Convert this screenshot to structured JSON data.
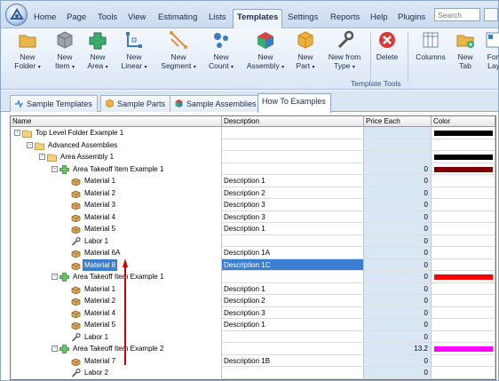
{
  "menu": {
    "items": [
      "Home",
      "Page",
      "Tools",
      "View",
      "Estimating",
      "Lists",
      "Templates",
      "Settings",
      "Reports",
      "Help",
      "Plugins"
    ],
    "active": "Templates",
    "search_placeholder": "Search"
  },
  "ribbon": {
    "buttons": [
      {
        "line1": "New",
        "line2": "Folder",
        "caret": true,
        "icon": "folder-icon"
      },
      {
        "line1": "New",
        "line2": "Item",
        "caret": true,
        "icon": "cube-icon"
      },
      {
        "line1": "New",
        "line2": "Area",
        "caret": true,
        "icon": "area-icon"
      },
      {
        "line1": "New",
        "line2": "Linear",
        "caret": true,
        "icon": "linear-icon"
      },
      {
        "line1": "New",
        "line2": "Segment",
        "caret": true,
        "icon": "segment-icon"
      },
      {
        "line1": "New",
        "line2": "Count",
        "caret": true,
        "icon": "count-icon"
      },
      {
        "line1": "New",
        "line2": "Assembly",
        "caret": true,
        "icon": "assembly-icon"
      },
      {
        "line1": "New",
        "line2": "Part",
        "caret": true,
        "icon": "part-icon"
      },
      {
        "line1": "New from",
        "line2": "Type",
        "caret": true,
        "icon": "wrench-icon"
      },
      {
        "line1": "Delete",
        "line2": "",
        "caret": false,
        "icon": "delete-icon"
      },
      {
        "line1": "Columns",
        "line2": "",
        "caret": false,
        "icon": "columns-icon"
      },
      {
        "line1": "New",
        "line2": "Tab",
        "caret": false,
        "icon": "new-tab-icon"
      },
      {
        "line1": "Fon",
        "line2": "Lay",
        "caret": false,
        "icon": "layout-icon"
      }
    ],
    "group_label": "Template Tools"
  },
  "tabs": [
    {
      "label": "Sample Templates",
      "icon": "templates-icon"
    },
    {
      "label": "Sample Parts",
      "icon": "parts-icon"
    },
    {
      "label": "Sample Assemblies",
      "icon": "assemblies-icon"
    },
    {
      "label": "How To Examples",
      "icon": ""
    }
  ],
  "active_tab": "How To Examples",
  "grid": {
    "columns": [
      "Name",
      "Description",
      "Price Each",
      "Color"
    ],
    "rows": [
      {
        "level": 0,
        "type": "folder",
        "name": "Top Level Folder Example 1",
        "desc": "",
        "price": "",
        "color": "#000000",
        "expander": "-"
      },
      {
        "level": 1,
        "type": "folder",
        "name": "Advanced Assemblies",
        "desc": "",
        "price": "",
        "color": "",
        "expander": "-"
      },
      {
        "level": 2,
        "type": "folder",
        "name": "Area Assembly 1",
        "desc": "",
        "price": "",
        "color": "#000000",
        "expander": "-"
      },
      {
        "level": 3,
        "type": "area",
        "name": "Area Takeoff Item Example 1",
        "desc": "",
        "price": "0",
        "color": "#7f0000",
        "expander": "-"
      },
      {
        "level": 4,
        "type": "material",
        "name": "Material 1",
        "desc": "Description 1",
        "price": "0",
        "color": ""
      },
      {
        "level": 4,
        "type": "material",
        "name": "Material 2",
        "desc": "Description 2",
        "price": "0",
        "color": ""
      },
      {
        "level": 4,
        "type": "material",
        "name": "Material 3",
        "desc": "Description 3",
        "price": "0",
        "color": ""
      },
      {
        "level": 4,
        "type": "material",
        "name": "Material 4",
        "desc": "Description 3",
        "price": "0",
        "color": ""
      },
      {
        "level": 4,
        "type": "material",
        "name": "Material 5",
        "desc": "Description 1",
        "price": "0",
        "color": ""
      },
      {
        "level": 4,
        "type": "labor",
        "name": "Labor 1",
        "desc": "",
        "price": "0",
        "color": ""
      },
      {
        "level": 4,
        "type": "material",
        "name": "Material 6A",
        "desc": "Description 1A",
        "price": "0",
        "color": ""
      },
      {
        "level": 4,
        "type": "material",
        "name": "Material 8",
        "desc": "Description 1C",
        "price": "0",
        "color": "",
        "selected": true
      },
      {
        "level": 3,
        "type": "area",
        "name": "Area Takeoff Item Example 1",
        "desc": "",
        "price": "0",
        "color": "#ff0000",
        "expander": "-"
      },
      {
        "level": 4,
        "type": "material",
        "name": "Material 1",
        "desc": "Description 1",
        "price": "0",
        "color": ""
      },
      {
        "level": 4,
        "type": "material",
        "name": "Material 2",
        "desc": "Description 2",
        "price": "0",
        "color": ""
      },
      {
        "level": 4,
        "type": "material",
        "name": "Material 4",
        "desc": "Description 3",
        "price": "0",
        "color": ""
      },
      {
        "level": 4,
        "type": "material",
        "name": "Material 5",
        "desc": "Description 1",
        "price": "0",
        "color": ""
      },
      {
        "level": 4,
        "type": "labor",
        "name": "Labor 1",
        "desc": "",
        "price": "0",
        "color": ""
      },
      {
        "level": 3,
        "type": "area",
        "name": "Area Takeoff Item Example 2",
        "desc": "",
        "price": "13.2",
        "color": "#ff00ff",
        "expander": "-"
      },
      {
        "level": 4,
        "type": "material",
        "name": "Material 7",
        "desc": "Description 1B",
        "price": "0",
        "color": ""
      },
      {
        "level": 4,
        "type": "labor",
        "name": "Labor 2",
        "desc": "",
        "price": "0",
        "color": ""
      }
    ]
  },
  "colors": {
    "accent": "#3c7fd2",
    "annotation_arrow": "#d40000"
  }
}
